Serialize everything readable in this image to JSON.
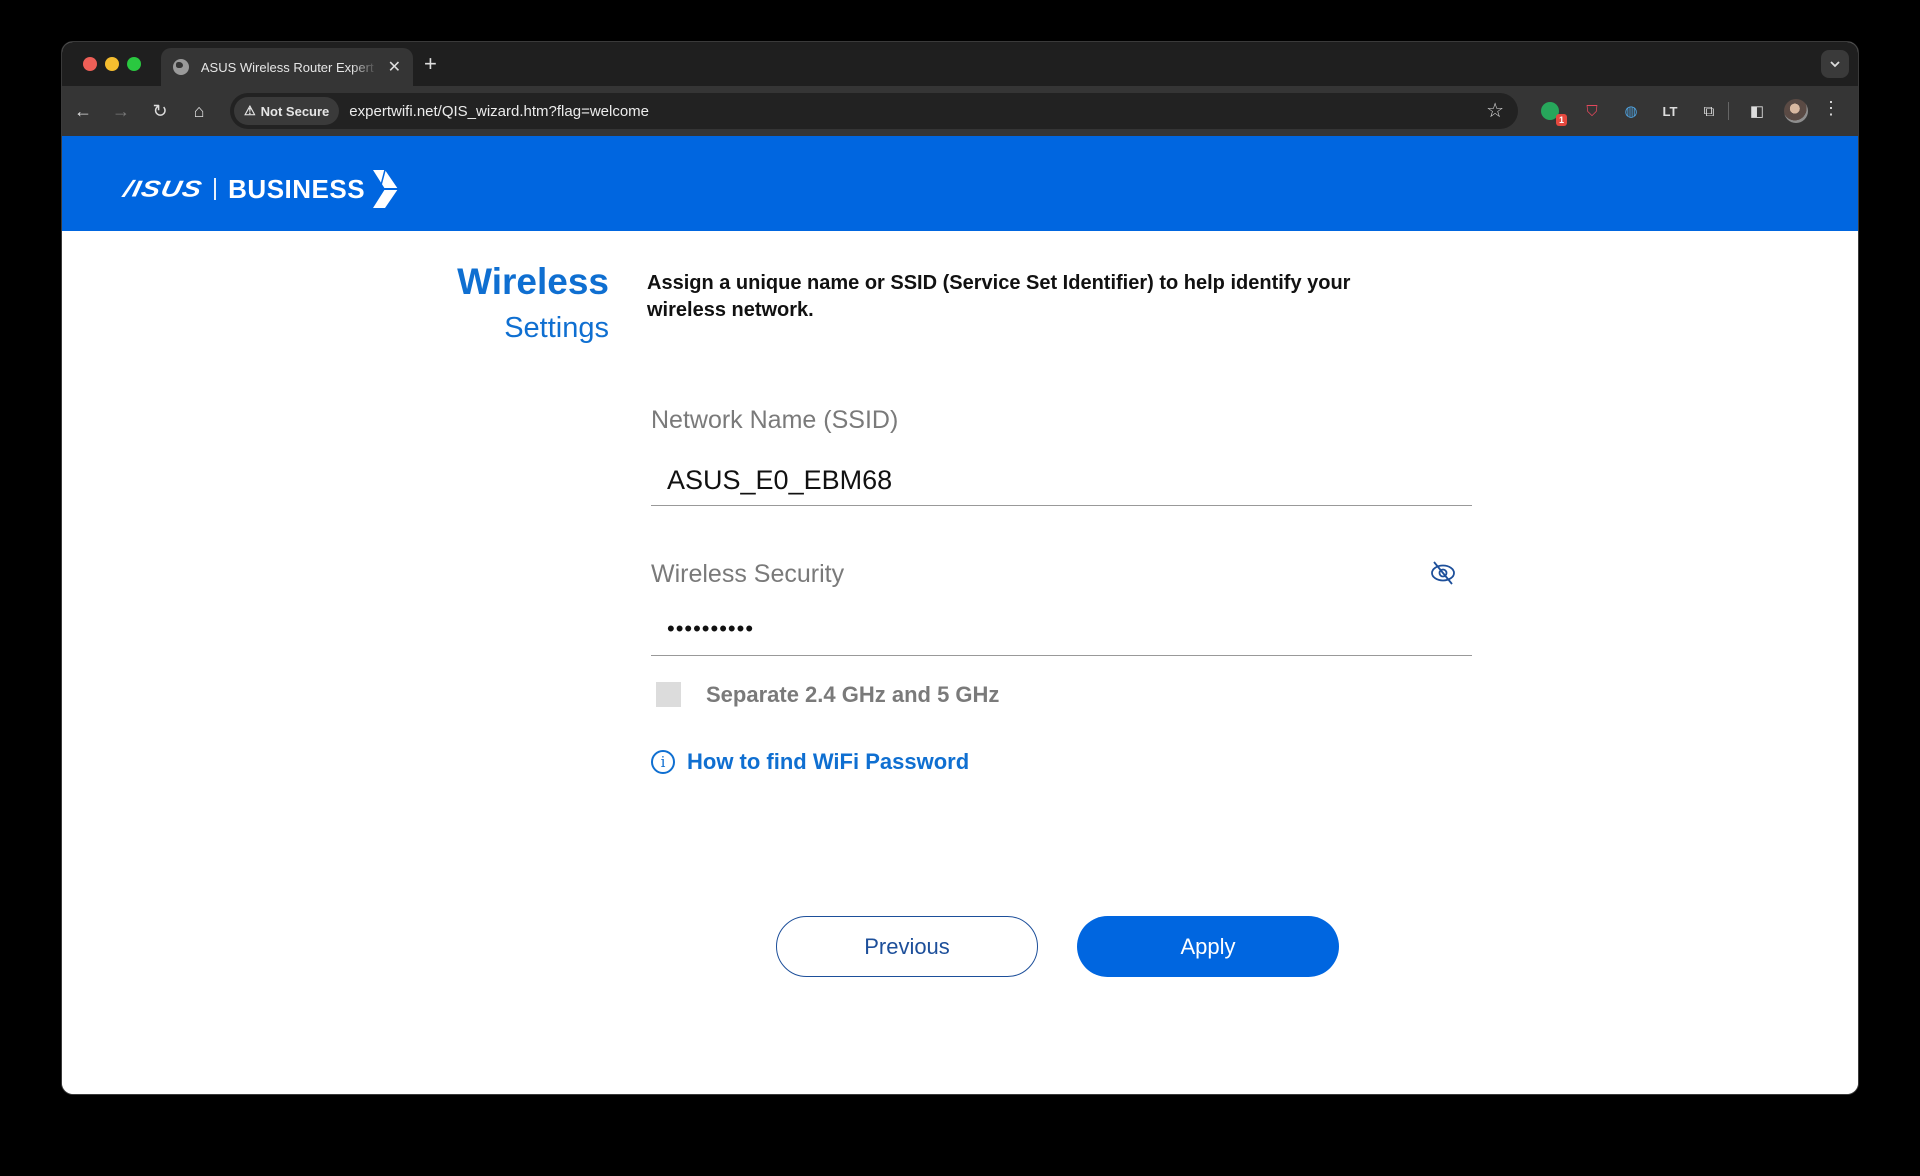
{
  "browser": {
    "tab_title": "ASUS Wireless Router Expert",
    "tab_close": "✕",
    "new_tab": "+",
    "tab_menu": "⌄",
    "security_label": "Not Secure",
    "security_icon": "⚠",
    "url": "expertwifi.net/QIS_wizard.htm?flag=welcome",
    "back_icon": "←",
    "forward_icon": "→",
    "reload_icon": "↻",
    "home_icon": "⌂",
    "star_icon": "☆",
    "kebab_icon": "⋮",
    "extensions": [
      {
        "name": "grammarly",
        "glyph": "",
        "badge": "1"
      },
      {
        "name": "pocket",
        "glyph": "⛉"
      },
      {
        "name": "1password",
        "glyph": "◍"
      },
      {
        "name": "languagetool",
        "glyph": "LT"
      },
      {
        "name": "extensions-puzzle",
        "glyph": "⧉"
      },
      {
        "name": "side-panel",
        "glyph": "◧"
      }
    ]
  },
  "header": {
    "brand": "/ISUS",
    "division": "BUSINESS",
    "color": "#0066e0"
  },
  "page": {
    "title_main": "Wireless",
    "title_sub": "Settings",
    "description": "Assign a unique name or SSID (Service Set Identifier) to help identify your wireless network.",
    "ssid": {
      "label": "Network Name (SSID)",
      "value": "ASUS_E0_EBM68"
    },
    "security": {
      "label": "Wireless Security",
      "value": "••••••••••",
      "visibility_icon": "eye-off"
    },
    "separate_bands": {
      "label": "Separate 2.4 GHz and 5 GHz",
      "checked": false
    },
    "help_link": {
      "icon": "i",
      "label": "How to find WiFi Password"
    },
    "buttons": {
      "previous": "Previous",
      "apply": "Apply"
    },
    "accent_color": "#0f6fd1"
  }
}
